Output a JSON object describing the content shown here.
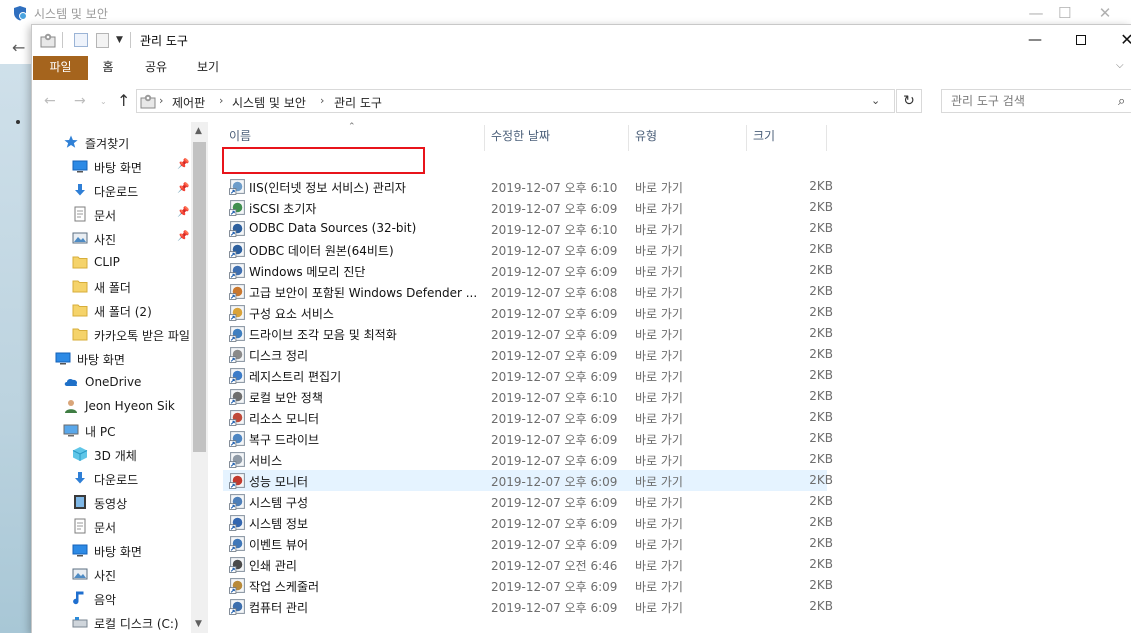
{
  "background_window": {
    "title": "시스템 및 보안",
    "minimize": "—",
    "maximize": "☐",
    "close": "✕",
    "back": "←"
  },
  "window": {
    "title": "관리 도구",
    "minimize": "—",
    "close": "✕"
  },
  "ribbon": {
    "tabs": [
      "파일",
      "홈",
      "공유",
      "보기"
    ],
    "active_tab": "파일",
    "active_color": "#a5641d",
    "expand": "⌵"
  },
  "address": {
    "back": "←",
    "forward": "→",
    "recent": "⌄",
    "up": "↑",
    "breadcrumb": [
      "제어판",
      "시스템 및 보안",
      "관리 도구"
    ],
    "separator": "›",
    "dropdown": "⌄",
    "refresh": "↻",
    "search_placeholder": "관리 도구 검색",
    "search_icon": "⌕"
  },
  "nav_pane": {
    "items": [
      {
        "label": "즐겨찾기",
        "icon": "star-icon",
        "indent": 1
      },
      {
        "label": "바탕 화면",
        "icon": "desktop-icon",
        "indent": 2,
        "pinned": true
      },
      {
        "label": "다운로드",
        "icon": "download-icon",
        "indent": 2,
        "pinned": true
      },
      {
        "label": "문서",
        "icon": "document-icon",
        "indent": 2,
        "pinned": true
      },
      {
        "label": "사진",
        "icon": "pictures-icon",
        "indent": 2,
        "pinned": true
      },
      {
        "label": "CLIP",
        "icon": "folder-icon",
        "indent": 2
      },
      {
        "label": "새 폴더",
        "icon": "folder-icon",
        "indent": 2
      },
      {
        "label": "새 폴더 (2)",
        "icon": "folder-icon",
        "indent": 2
      },
      {
        "label": "카카오톡 받은 파일",
        "icon": "folder-icon",
        "indent": 2
      },
      {
        "label": "바탕 화면",
        "icon": "desktop-icon",
        "indent": 0
      },
      {
        "label": "OneDrive",
        "icon": "cloud-icon",
        "indent": 1
      },
      {
        "label": "Jeon Hyeon Sik",
        "icon": "user-icon",
        "indent": 1
      },
      {
        "label": "내 PC",
        "icon": "pc-icon",
        "indent": 1
      },
      {
        "label": "3D 개체",
        "icon": "cube-icon",
        "indent": 2
      },
      {
        "label": "다운로드",
        "icon": "download-icon",
        "indent": 2
      },
      {
        "label": "동영상",
        "icon": "video-icon",
        "indent": 2
      },
      {
        "label": "문서",
        "icon": "document-icon",
        "indent": 2
      },
      {
        "label": "바탕 화면",
        "icon": "desktop-icon",
        "indent": 2
      },
      {
        "label": "사진",
        "icon": "pictures-icon",
        "indent": 2
      },
      {
        "label": "음악",
        "icon": "music-icon",
        "indent": 2
      },
      {
        "label": "로컬 디스크 (C:)",
        "icon": "disk-icon",
        "indent": 2
      }
    ],
    "pin_glyph": "📌",
    "scroll_up": "▲",
    "scroll_down": "▼"
  },
  "file_list": {
    "columns": {
      "name": "이름",
      "date": "수정한 날짜",
      "type": "유형",
      "size": "크기"
    },
    "sort_glyph": "⌃",
    "rows": [
      {
        "name": "IIS(인터넷 정보 서비스) 관리자",
        "date": "2019-12-07 오후 6:10",
        "type": "바로 가기",
        "size": "2KB",
        "icon": "iis-icon"
      },
      {
        "name": "iSCSI 초기자",
        "date": "2019-12-07 오후 6:09",
        "type": "바로 가기",
        "size": "2KB",
        "icon": "iscsi-icon"
      },
      {
        "name": "ODBC Data Sources (32-bit)",
        "date": "2019-12-07 오후 6:10",
        "type": "바로 가기",
        "size": "2KB",
        "icon": "odbc-icon"
      },
      {
        "name": "ODBC 데이터 원본(64비트)",
        "date": "2019-12-07 오후 6:09",
        "type": "바로 가기",
        "size": "2KB",
        "icon": "odbc-icon"
      },
      {
        "name": "Windows 메모리 진단",
        "date": "2019-12-07 오후 6:09",
        "type": "바로 가기",
        "size": "2KB",
        "icon": "memory-diagnostic-icon"
      },
      {
        "name": "고급 보안이 포함된 Windows Defender ...",
        "date": "2019-12-07 오후 6:08",
        "type": "바로 가기",
        "size": "2KB",
        "icon": "firewall-icon"
      },
      {
        "name": "구성 요소 서비스",
        "date": "2019-12-07 오후 6:09",
        "type": "바로 가기",
        "size": "2KB",
        "icon": "component-services-icon"
      },
      {
        "name": "드라이브 조각 모음 및 최적화",
        "date": "2019-12-07 오후 6:09",
        "type": "바로 가기",
        "size": "2KB",
        "icon": "defrag-icon"
      },
      {
        "name": "디스크 정리",
        "date": "2019-12-07 오후 6:09",
        "type": "바로 가기",
        "size": "2KB",
        "icon": "disk-cleanup-icon"
      },
      {
        "name": "레지스트리 편집기",
        "date": "2019-12-07 오후 6:09",
        "type": "바로 가기",
        "size": "2KB",
        "icon": "registry-icon"
      },
      {
        "name": "로컬 보안 정책",
        "date": "2019-12-07 오후 6:10",
        "type": "바로 가기",
        "size": "2KB",
        "icon": "security-policy-icon"
      },
      {
        "name": "리소스 모니터",
        "date": "2019-12-07 오후 6:09",
        "type": "바로 가기",
        "size": "2KB",
        "icon": "resource-monitor-icon"
      },
      {
        "name": "복구 드라이브",
        "date": "2019-12-07 오후 6:09",
        "type": "바로 가기",
        "size": "2KB",
        "icon": "recovery-drive-icon"
      },
      {
        "name": "서비스",
        "date": "2019-12-07 오후 6:09",
        "type": "바로 가기",
        "size": "2KB",
        "icon": "services-icon"
      },
      {
        "name": "성능 모니터",
        "date": "2019-12-07 오후 6:09",
        "type": "바로 가기",
        "size": "2KB",
        "icon": "performance-monitor-icon"
      },
      {
        "name": "시스템 구성",
        "date": "2019-12-07 오후 6:09",
        "type": "바로 가기",
        "size": "2KB",
        "icon": "system-config-icon"
      },
      {
        "name": "시스템 정보",
        "date": "2019-12-07 오후 6:09",
        "type": "바로 가기",
        "size": "2KB",
        "icon": "system-info-icon"
      },
      {
        "name": "이벤트 뷰어",
        "date": "2019-12-07 오후 6:09",
        "type": "바로 가기",
        "size": "2KB",
        "icon": "event-viewer-icon"
      },
      {
        "name": "인쇄 관리",
        "date": "2019-12-07 오전 6:46",
        "type": "바로 가기",
        "size": "2KB",
        "icon": "print-management-icon"
      },
      {
        "name": "작업 스케줄러",
        "date": "2019-12-07 오후 6:09",
        "type": "바로 가기",
        "size": "2KB",
        "icon": "task-scheduler-icon"
      },
      {
        "name": "컴퓨터 관리",
        "date": "2019-12-07 오후 6:09",
        "type": "바로 가기",
        "size": "2KB",
        "icon": "computer-management-icon"
      }
    ],
    "hovered_row": 14,
    "highlighted_row": 0,
    "highlight_color": "#e8141b"
  }
}
